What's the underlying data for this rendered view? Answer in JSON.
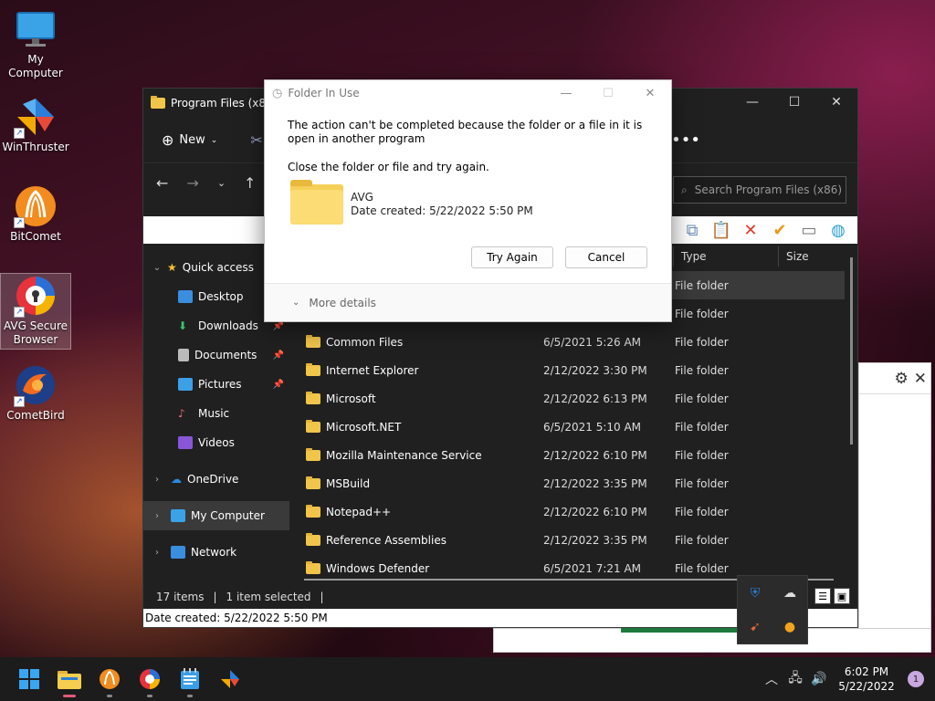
{
  "desktop": {
    "icons": [
      {
        "label": "My Computer"
      },
      {
        "label": "WinThruster"
      },
      {
        "label": "BitComet"
      },
      {
        "label": "AVG Secure Browser"
      },
      {
        "label": "CometBird"
      }
    ]
  },
  "explorer": {
    "title": "Program Files (x86)",
    "new_label": "New",
    "search_placeholder": "Search Program Files (x86)",
    "columns": {
      "type": "Type",
      "size": "Size"
    },
    "nav": [
      {
        "label": "Quick access"
      },
      {
        "label": "Desktop"
      },
      {
        "label": "Downloads"
      },
      {
        "label": "Documents"
      },
      {
        "label": "Pictures"
      },
      {
        "label": "Music"
      },
      {
        "label": "Videos"
      },
      {
        "label": "OneDrive"
      },
      {
        "label": "My Computer"
      },
      {
        "label": "Network"
      }
    ],
    "rows": [
      {
        "name": "",
        "date": "",
        "type": "File folder"
      },
      {
        "name": "",
        "date": "",
        "type": "File folder"
      },
      {
        "name": "Common Files",
        "date": "6/5/2021 5:26 AM",
        "type": "File folder"
      },
      {
        "name": "Internet Explorer",
        "date": "2/12/2022 3:30 PM",
        "type": "File folder"
      },
      {
        "name": "Microsoft",
        "date": "2/12/2022 6:13 PM",
        "type": "File folder"
      },
      {
        "name": "Microsoft.NET",
        "date": "6/5/2021 5:10 AM",
        "type": "File folder"
      },
      {
        "name": "Mozilla Maintenance Service",
        "date": "2/12/2022 6:10 PM",
        "type": "File folder"
      },
      {
        "name": "MSBuild",
        "date": "2/12/2022 3:35 PM",
        "type": "File folder"
      },
      {
        "name": "Notepad++",
        "date": "2/12/2022 6:10 PM",
        "type": "File folder"
      },
      {
        "name": "Reference Assemblies",
        "date": "2/12/2022 3:35 PM",
        "type": "File folder"
      },
      {
        "name": "Windows Defender",
        "date": "6/5/2021 7:21 AM",
        "type": "File folder"
      }
    ],
    "status": {
      "items": "17 items",
      "selected": "1 item selected"
    },
    "date_created_bar": "Date created: 5/22/2022 5:50 PM"
  },
  "dialog": {
    "title": "Folder In Use",
    "message": "The action can't be completed because the folder or a file in it is open in another program",
    "instruction": "Close the folder or file and try again.",
    "file_name": "AVG",
    "file_date": "Date created: 5/22/2022 5:50 PM",
    "try_again_label": "Try Again",
    "cancel_label": "Cancel",
    "more_details_label": "More details"
  },
  "taskbar": {
    "time": "6:02 PM",
    "date": "5/22/2022",
    "notification_count": "1"
  }
}
